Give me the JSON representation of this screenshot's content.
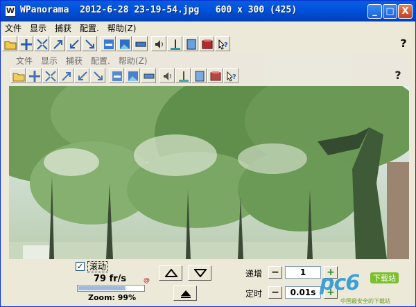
{
  "window": {
    "title": "WPanorama  2012-6-28 23-19-54.jpg   600 x 300 (425)",
    "app_icon": "W",
    "controls": {
      "minimize": "_",
      "maximize": "□",
      "close": "X"
    }
  },
  "menu": [
    "文件",
    "显示",
    "捕获",
    "配置.",
    "帮助(Z)"
  ],
  "inner_menu": [
    "文件",
    "显示",
    "捕获",
    "配置.",
    "帮助(Z)"
  ],
  "toolbar_icons": [
    "open-folder-icon",
    "zoom-in-icon",
    "zoom-out-icon",
    "arrow-ne-icon",
    "arrow-sw-icon",
    "arrow-se-icon",
    "fit-image-icon",
    "image-icon",
    "bar-icon",
    "speaker-icon",
    "level-icon",
    "frame-icon",
    "book-icon",
    "help-cursor-icon"
  ],
  "help_label": "?",
  "controls": {
    "scroll_checkbox_label": "滚动",
    "scroll_checked": "✓",
    "fps": "79 fr/s",
    "fps_icon": "@",
    "speed_fraction": 0.72,
    "zoom": "Zoom: 99%",
    "increment_label": "递增",
    "increment_value": "1",
    "timer_label": "定时",
    "timer_value": "0.01s",
    "minus": "−",
    "plus": "+"
  },
  "watermark": {
    "brand": "pc6",
    "tag": "下载站",
    "sub": "中国最安全的下载站"
  }
}
